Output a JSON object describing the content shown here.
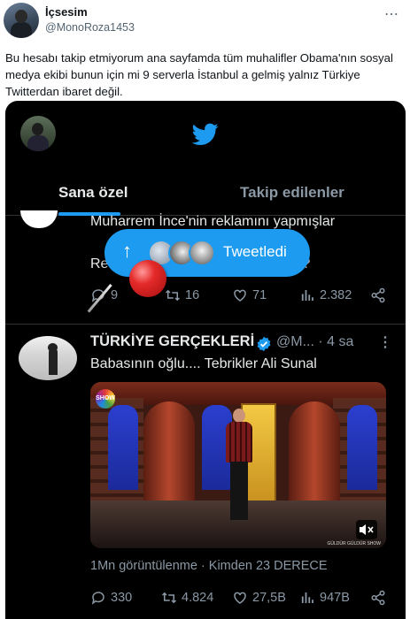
{
  "outer_tweet": {
    "display_name": "İçsesim",
    "handle": "@MonoRoza1453",
    "more": "⋯",
    "text": "Bu hesabı takip etmiyorum ana sayfamda tüm muhalifler Obama'nın sosyal medya ekibi bunun için mi 9 serverla İstanbul a gelmiş yalnız Türkiye Twitterdan ibaret değil."
  },
  "screenshot": {
    "tabs": [
      {
        "label": "Sana özel",
        "active": true
      },
      {
        "label": "Takip edilenler",
        "active": false
      }
    ],
    "previous_tweet": {
      "text_line_1": "Muharrem İnce'nin reklamını yapmışlar",
      "text_line_2_start": "Re",
      "text_line_2_end": "k ?",
      "replies": "9",
      "retweets": "16",
      "likes": "71",
      "views": "2.382"
    },
    "retweet_pill": {
      "label": "Tweetledi",
      "arrow": "↑"
    },
    "tweet": {
      "name": "TÜRKİYE GERÇEKLERİ",
      "handle": "@M...",
      "time": "· 4 sa",
      "more": "⋮",
      "text": "Babasının oğlu.... Tebrikler Ali Sunal",
      "video_logo": "SHOW",
      "video_watermark": "GÜLDÜR GÜLDÜR SHOW",
      "views_line": "1Mn görüntülenme · Kimden 23 DERECE",
      "replies": "330",
      "retweets": "4.824",
      "likes": "27,5B",
      "views": "947B"
    }
  },
  "colors": {
    "accent": "#1d9bf0",
    "muted": "#8b98a5",
    "pin": "#e52a2a"
  }
}
